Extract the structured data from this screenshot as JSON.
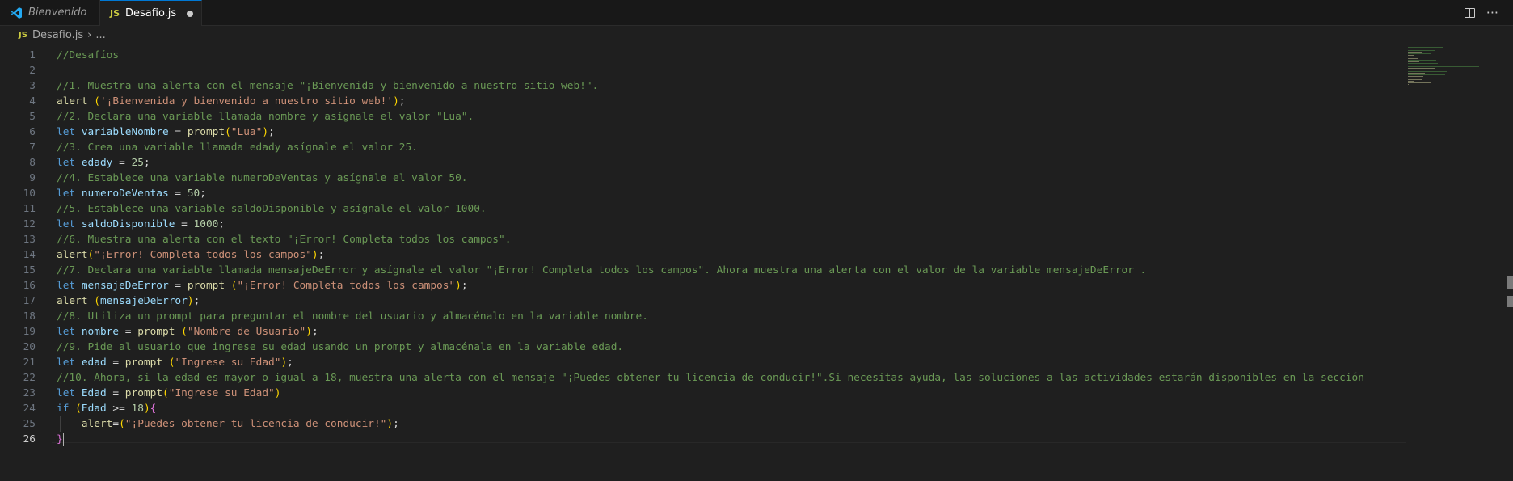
{
  "tabs": {
    "welcome": "Bienvenido",
    "active": "Desafio.js",
    "js_badge": "JS"
  },
  "breadcrumb": {
    "file": "Desafio.js",
    "rest": "..."
  },
  "editor": {
    "current_line": 26,
    "lines": [
      [
        [
          "cm",
          "//Desafíos"
        ]
      ],
      [],
      [
        [
          "cm",
          "//1. Muestra una alerta con el mensaje \"¡Bienvenida y bienvenido a nuestro sitio web!\"."
        ]
      ],
      [
        [
          "fn",
          "alert"
        ],
        [
          "p",
          " "
        ],
        [
          "br1",
          "("
        ],
        [
          "str",
          "'¡Bienvenida y bienvenido a nuestro sitio web!'"
        ],
        [
          "br1",
          ")"
        ],
        [
          "p",
          ";"
        ]
      ],
      [
        [
          "cm",
          "//2. Declara una variable llamada nombre y asígnale el valor \"Lua\"."
        ]
      ],
      [
        [
          "kw",
          "let"
        ],
        [
          "p",
          " "
        ],
        [
          "var",
          "variableNombre"
        ],
        [
          "p",
          " = "
        ],
        [
          "fn",
          "prompt"
        ],
        [
          "br1",
          "("
        ],
        [
          "str",
          "\"Lua\""
        ],
        [
          "br1",
          ")"
        ],
        [
          "p",
          ";"
        ]
      ],
      [
        [
          "cm",
          "//3. Crea una variable llamada edady asígnale el valor 25."
        ]
      ],
      [
        [
          "kw",
          "let"
        ],
        [
          "p",
          " "
        ],
        [
          "var",
          "edady"
        ],
        [
          "p",
          " = "
        ],
        [
          "num",
          "25"
        ],
        [
          "p",
          ";"
        ]
      ],
      [
        [
          "cm",
          "//4. Establece una variable numeroDeVentas y asígnale el valor 50."
        ]
      ],
      [
        [
          "kw",
          "let"
        ],
        [
          "p",
          " "
        ],
        [
          "var",
          "numeroDeVentas"
        ],
        [
          "p",
          " = "
        ],
        [
          "num",
          "50"
        ],
        [
          "p",
          ";"
        ]
      ],
      [
        [
          "cm",
          "//5. Establece una variable saldoDisponible y asígnale el valor 1000."
        ]
      ],
      [
        [
          "kw",
          "let"
        ],
        [
          "p",
          " "
        ],
        [
          "var",
          "saldoDisponible"
        ],
        [
          "p",
          " = "
        ],
        [
          "num",
          "1000"
        ],
        [
          "p",
          ";"
        ]
      ],
      [
        [
          "cm",
          "//6. Muestra una alerta con el texto \"¡Error! Completa todos los campos\"."
        ]
      ],
      [
        [
          "fn",
          "alert"
        ],
        [
          "br1",
          "("
        ],
        [
          "str",
          "\"¡Error! Completa todos los campos\""
        ],
        [
          "br1",
          ")"
        ],
        [
          "p",
          ";"
        ]
      ],
      [
        [
          "cm",
          "//7. Declara una variable llamada mensajeDeError y asígnale el valor \"¡Error! Completa todos los campos\". Ahora muestra una alerta con el valor de la variable mensajeDeError ."
        ]
      ],
      [
        [
          "kw",
          "let"
        ],
        [
          "p",
          " "
        ],
        [
          "var",
          "mensajeDeError"
        ],
        [
          "p",
          " = "
        ],
        [
          "fn",
          "prompt"
        ],
        [
          "p",
          " "
        ],
        [
          "br1",
          "("
        ],
        [
          "str",
          "\"¡Error! Completa todos los campos\""
        ],
        [
          "br1",
          ")"
        ],
        [
          "p",
          ";"
        ]
      ],
      [
        [
          "fn",
          "alert"
        ],
        [
          "p",
          " "
        ],
        [
          "br1",
          "("
        ],
        [
          "var",
          "mensajeDeError"
        ],
        [
          "br1",
          ")"
        ],
        [
          "p",
          ";"
        ]
      ],
      [
        [
          "cm",
          "//8. Utiliza un prompt para preguntar el nombre del usuario y almacénalo en la variable nombre."
        ]
      ],
      [
        [
          "kw",
          "let"
        ],
        [
          "p",
          " "
        ],
        [
          "var",
          "nombre"
        ],
        [
          "p",
          " = "
        ],
        [
          "fn",
          "prompt"
        ],
        [
          "p",
          " "
        ],
        [
          "br1",
          "("
        ],
        [
          "str",
          "\"Nombre de Usuario\""
        ],
        [
          "br1",
          ")"
        ],
        [
          "p",
          ";"
        ]
      ],
      [
        [
          "cm",
          "//9. Pide al usuario que ingrese su edad usando un prompt y almacénala en la variable edad."
        ]
      ],
      [
        [
          "kw",
          "let"
        ],
        [
          "p",
          " "
        ],
        [
          "var",
          "edad"
        ],
        [
          "p",
          " = "
        ],
        [
          "fn",
          "prompt"
        ],
        [
          "p",
          " "
        ],
        [
          "br1",
          "("
        ],
        [
          "str",
          "\"Ingrese su Edad\""
        ],
        [
          "br1",
          ")"
        ],
        [
          "p",
          ";"
        ]
      ],
      [
        [
          "cm",
          "//10. Ahora, si la edad es mayor o igual a 18, muestra una alerta con el mensaje \"¡Puedes obtener tu licencia de conducir!\".Si necesitas ayuda, las soluciones a las actividades estarán disponibles en la sección"
        ]
      ],
      [
        [
          "kw",
          "let"
        ],
        [
          "p",
          " "
        ],
        [
          "var",
          "Edad"
        ],
        [
          "p",
          " = "
        ],
        [
          "fn",
          "prompt"
        ],
        [
          "br1",
          "("
        ],
        [
          "str",
          "\"Ingrese su Edad\""
        ],
        [
          "br1",
          ")"
        ]
      ],
      [
        [
          "kw",
          "if"
        ],
        [
          "p",
          " "
        ],
        [
          "br1",
          "("
        ],
        [
          "var",
          "Edad"
        ],
        [
          "p",
          " >= "
        ],
        [
          "num",
          "18"
        ],
        [
          "br1",
          ")"
        ],
        [
          "br2",
          "{"
        ]
      ],
      [
        [
          "p",
          "    "
        ],
        [
          "fn",
          "alert"
        ],
        [
          "p",
          "="
        ],
        [
          "br1",
          "("
        ],
        [
          "str",
          "\"¡Puedes obtener tu licencia de conducir!\""
        ],
        [
          "br1",
          ")"
        ],
        [
          "p",
          ";"
        ]
      ],
      [
        [
          "br2",
          "}"
        ]
      ]
    ]
  },
  "icons": {
    "split": "split-editor-icon",
    "more": "more-actions-icon",
    "more_glyph": "···",
    "breadcrumb_chevron": "›"
  },
  "colors": {
    "accent": "#0078d4",
    "background": "#1f1f1f",
    "comment": "#6a9955",
    "keyword": "#569cd6",
    "string": "#ce9178"
  }
}
